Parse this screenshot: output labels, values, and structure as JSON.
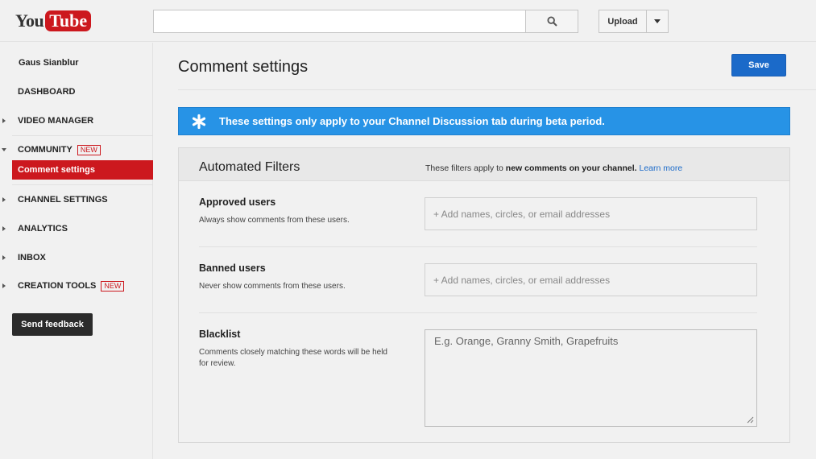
{
  "header": {
    "logo_you": "You",
    "logo_tube": "Tube",
    "search_placeholder": "",
    "upload_label": "Upload"
  },
  "sidebar": {
    "user_name": "Gaus Sianblur",
    "items": [
      {
        "label": "DASHBOARD"
      },
      {
        "label": "VIDEO MANAGER"
      },
      {
        "label": "COMMUNITY",
        "badge": "NEW"
      },
      {
        "label": "Comment settings"
      },
      {
        "label": "CHANNEL SETTINGS"
      },
      {
        "label": "ANALYTICS"
      },
      {
        "label": "INBOX"
      },
      {
        "label": "CREATION TOOLS",
        "badge": "NEW"
      }
    ],
    "feedback_label": "Send feedback"
  },
  "main": {
    "title": "Comment settings",
    "save_label": "Save",
    "banner_text": "These settings only apply to your Channel Discussion tab during beta period.",
    "panel": {
      "title": "Automated Filters",
      "note_prefix": "These filters apply to ",
      "note_bold": "new comments on your channel.",
      "note_link": "Learn more",
      "rows": [
        {
          "title": "Approved users",
          "desc": "Always show comments from these users.",
          "placeholder": "+ Add names, circles, or email addresses"
        },
        {
          "title": "Banned users",
          "desc": "Never show comments from these users.",
          "placeholder": "+ Add names, circles, or email addresses"
        },
        {
          "title": "Blacklist",
          "desc": "Comments closely matching these words will be held for review.",
          "placeholder": "E.g. Orange, Granny Smith, Grapefruits"
        }
      ]
    }
  },
  "colors": {
    "brand_red": "#cc181e",
    "save_blue": "#1b6ac9",
    "banner_blue": "#2793e6"
  },
  "icons": {
    "search": "search-icon",
    "banner": "asterisk-icon",
    "dropdown": "chevron-down-icon"
  }
}
